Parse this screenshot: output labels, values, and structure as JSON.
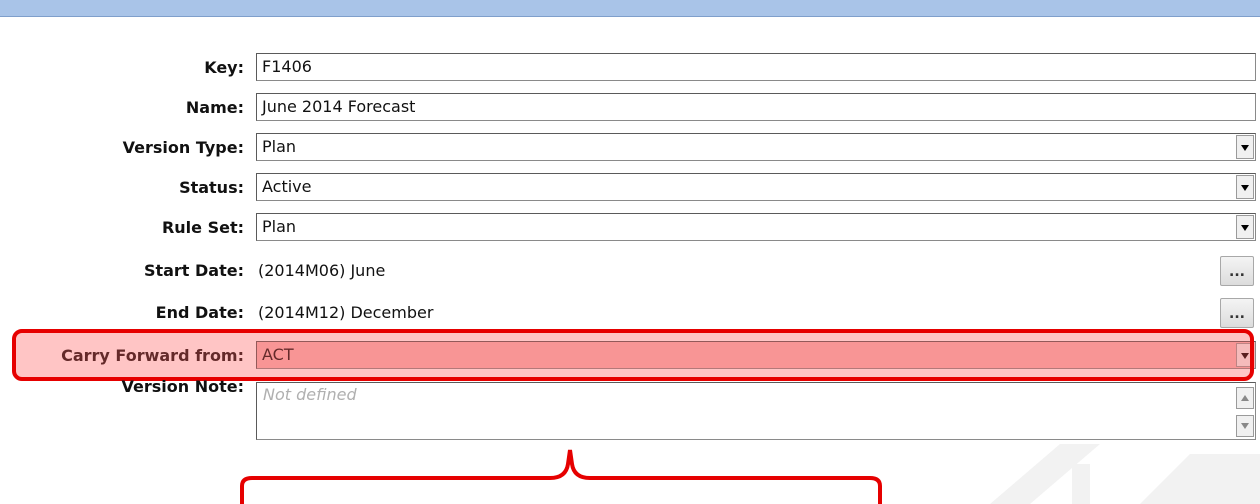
{
  "form": {
    "key": {
      "label": "Key:",
      "value": "F1406"
    },
    "name": {
      "label": "Name:",
      "value": "June 2014 Forecast"
    },
    "version_type": {
      "label": "Version Type:",
      "value": "Plan"
    },
    "status": {
      "label": "Status:",
      "value": "Active"
    },
    "rule_set": {
      "label": "Rule Set:",
      "value": "Plan"
    },
    "start_date": {
      "label": "Start Date:",
      "value": "(2014M06) June",
      "button": "..."
    },
    "end_date": {
      "label": "End Date:",
      "value": "(2014M12) December",
      "button": "..."
    },
    "carry_forward": {
      "label": "Carry Forward from:",
      "value": "ACT"
    },
    "version_note": {
      "label": "Version Note:",
      "placeholder": "Not defined"
    }
  },
  "colors": {
    "highlight": "#e60000",
    "topbar": "#a9c4e8"
  }
}
